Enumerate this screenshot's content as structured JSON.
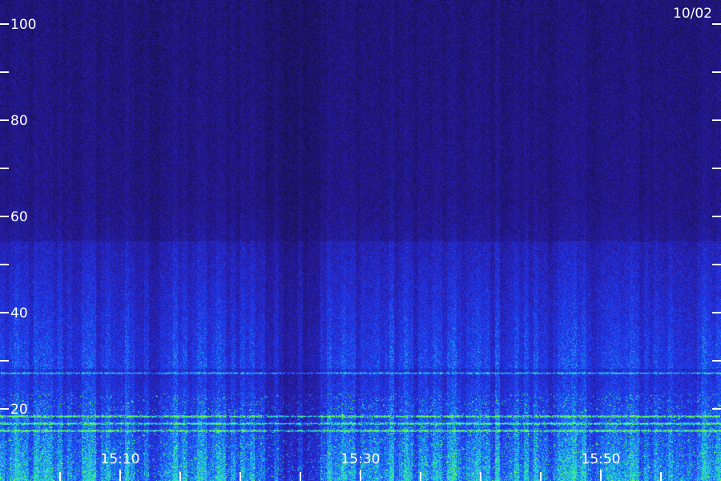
{
  "chart_data": {
    "type": "heatmap",
    "date_label": "10/02",
    "y_axis": {
      "range": [
        15,
        110
      ],
      "labeled_ticks": [
        20,
        40,
        60,
        80,
        100
      ],
      "labeled_tick_labels": [
        "20",
        "40",
        "60",
        "80",
        "100"
      ],
      "minor_ticks": [
        30,
        50,
        70,
        90
      ]
    },
    "x_axis": {
      "labeled_ticks": [
        "15:10",
        "15:30",
        "15:50"
      ],
      "minor_ticks": [
        "15:05",
        "15:15",
        "15:20",
        "15:25",
        "15:35",
        "15:40",
        "15:45",
        "15:55"
      ]
    },
    "bands": [
      {
        "level": 27.5,
        "intensity": "cyan"
      },
      {
        "level": 18.5,
        "intensity": "green"
      },
      {
        "level": 17,
        "intensity": "green"
      },
      {
        "level": 15.5,
        "intensity": "green"
      }
    ],
    "colors": {
      "low": "#1a1050",
      "mid": "#2a2aff",
      "high": "#22d0e0",
      "peak": "#60ff40"
    }
  }
}
